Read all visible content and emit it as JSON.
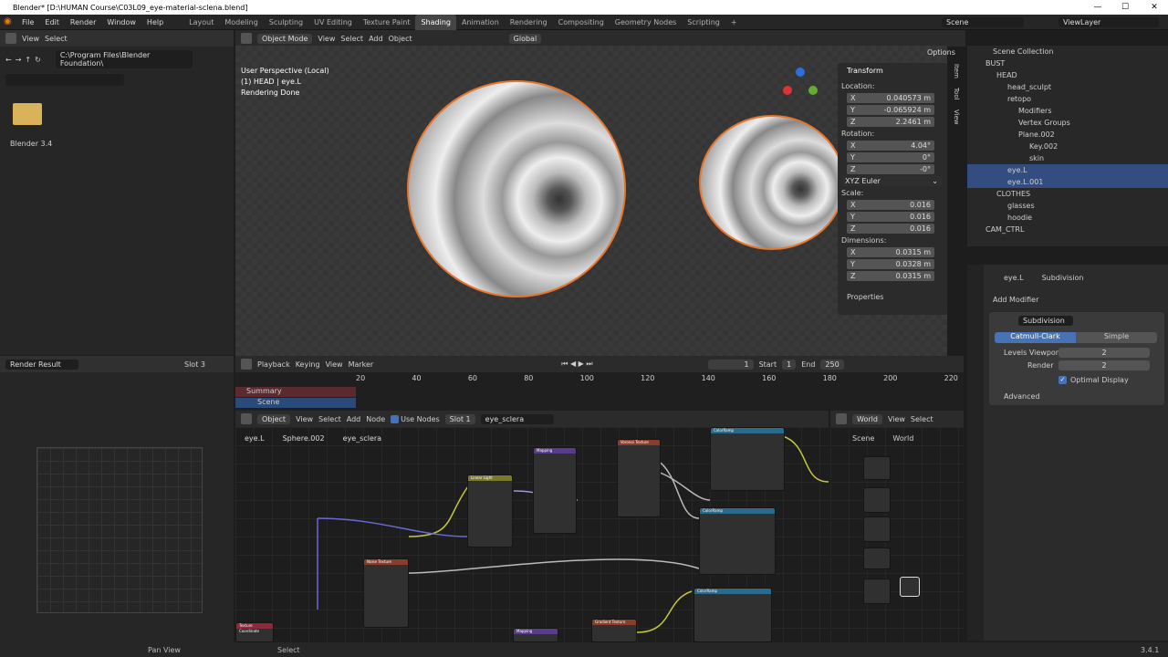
{
  "window": {
    "title": "Blender* [D:\\HUMAN Course\\C03L09_eye-material-sclena.blend]",
    "min": "—",
    "max": "☐",
    "close": "✕"
  },
  "menu": {
    "items": [
      "File",
      "Edit",
      "Render",
      "Window",
      "Help"
    ],
    "tabs": [
      "Layout",
      "Modeling",
      "Sculpting",
      "UV Editing",
      "Texture Paint",
      "Shading",
      "Animation",
      "Rendering",
      "Compositing",
      "Geometry Nodes",
      "Scripting"
    ],
    "active_tab": "Shading",
    "add_tab": "+",
    "scene": "Scene",
    "view_layer": "ViewLayer"
  },
  "filebrowser": {
    "view": "View",
    "select": "Select",
    "path": "C:\\Program Files\\Blender Foundation\\",
    "folder_label": "Blender 3.4"
  },
  "viewport": {
    "mode": "Object Mode",
    "menus": [
      "View",
      "Select",
      "Add",
      "Object"
    ],
    "orientation": "Global",
    "options": "Options",
    "info": [
      "User Perspective (Local)",
      "(1) HEAD | eye.L",
      "Rendering Done"
    ]
  },
  "npanel": {
    "section": "Transform",
    "location_label": "Location:",
    "location": [
      [
        "X",
        "0.040573 m"
      ],
      [
        "Y",
        "-0.065924 m"
      ],
      [
        "Z",
        "2.2461 m"
      ]
    ],
    "rotation_label": "Rotation:",
    "rotation": [
      [
        "X",
        "4.04°"
      ],
      [
        "Y",
        "0°"
      ],
      [
        "Z",
        "-0°"
      ]
    ],
    "rotation_mode": "XYZ Euler",
    "scale_label": "Scale:",
    "scale": [
      [
        "X",
        "0.016"
      ],
      [
        "Y",
        "0.016"
      ],
      [
        "Z",
        "0.016"
      ]
    ],
    "dimensions_label": "Dimensions:",
    "dimensions": [
      [
        "X",
        "0.0315 m"
      ],
      [
        "Y",
        "0.0328 m"
      ],
      [
        "Z",
        "0.0315 m"
      ]
    ],
    "properties": "Properties",
    "tabs": [
      "Item",
      "Tool",
      "View"
    ]
  },
  "outliner": {
    "title": "Scene Collection",
    "rows": [
      {
        "label": "BUST",
        "indent": 1,
        "sel": false
      },
      {
        "label": "HEAD",
        "indent": 2,
        "sel": false
      },
      {
        "label": "head_sculpt",
        "indent": 3,
        "sel": false
      },
      {
        "label": "retopo",
        "indent": 3,
        "sel": false
      },
      {
        "label": "Modifiers",
        "indent": 4,
        "sel": false
      },
      {
        "label": "Vertex Groups",
        "indent": 4,
        "sel": false
      },
      {
        "label": "Plane.002",
        "indent": 4,
        "sel": false
      },
      {
        "label": "Key.002",
        "indent": 5,
        "sel": false
      },
      {
        "label": "skin",
        "indent": 5,
        "sel": false
      },
      {
        "label": "eye.L",
        "indent": 3,
        "sel": true
      },
      {
        "label": "eye.L.001",
        "indent": 3,
        "sel": true
      },
      {
        "label": "CLOTHES",
        "indent": 2,
        "sel": false
      },
      {
        "label": "glasses",
        "indent": 3,
        "sel": false
      },
      {
        "label": "hoodie",
        "indent": 3,
        "sel": false
      },
      {
        "label": "CAM_CTRL",
        "indent": 1,
        "sel": false
      }
    ]
  },
  "props": {
    "object": "eye.L",
    "modifier_crumb": "Subdivision",
    "add_modifier": "Add Modifier",
    "modifier_name": "Subdivision",
    "catmull": "Catmull-Clark",
    "simple": "Simple",
    "levels_viewport_label": "Levels Viewport",
    "levels_viewport": "2",
    "render_label": "Render",
    "render": "2",
    "optimal": "Optimal Display",
    "advanced": "Advanced"
  },
  "render": {
    "title": "Render Result",
    "slot": "Slot 3"
  },
  "timeline": {
    "playback": "Playback",
    "keying": "Keying",
    "view": "View",
    "marker": "Marker",
    "frame": "1",
    "start_label": "Start",
    "start": "1",
    "end_label": "End",
    "end": "250",
    "ticks": [
      "20",
      "40",
      "60",
      "80",
      "100",
      "120",
      "140",
      "160",
      "180",
      "200",
      "220"
    ],
    "summary": "Summary",
    "scene": "Scene"
  },
  "nodes": {
    "type": "Object",
    "menus": [
      "View",
      "Select",
      "Add",
      "Node"
    ],
    "use_nodes": "Use Nodes",
    "slot": "Slot 1",
    "material": "eye_sclera",
    "crumb": [
      "eye.L",
      "Sphere.002",
      "eye_sclera"
    ],
    "node_titles": [
      "Mapping",
      "Voronoi Texture",
      "ColorRamp",
      "Linear Light",
      "ColorRamp",
      "Noise Texture",
      "ColorRamp",
      "Texture Coordinate",
      "Mapping",
      "Gradient Texture"
    ]
  },
  "world": {
    "type": "World",
    "view": "View",
    "select": "Select",
    "crumb": [
      "Scene",
      "World"
    ]
  },
  "status": {
    "pan": "Pan View",
    "select": "Select",
    "version": "3.4.1"
  }
}
